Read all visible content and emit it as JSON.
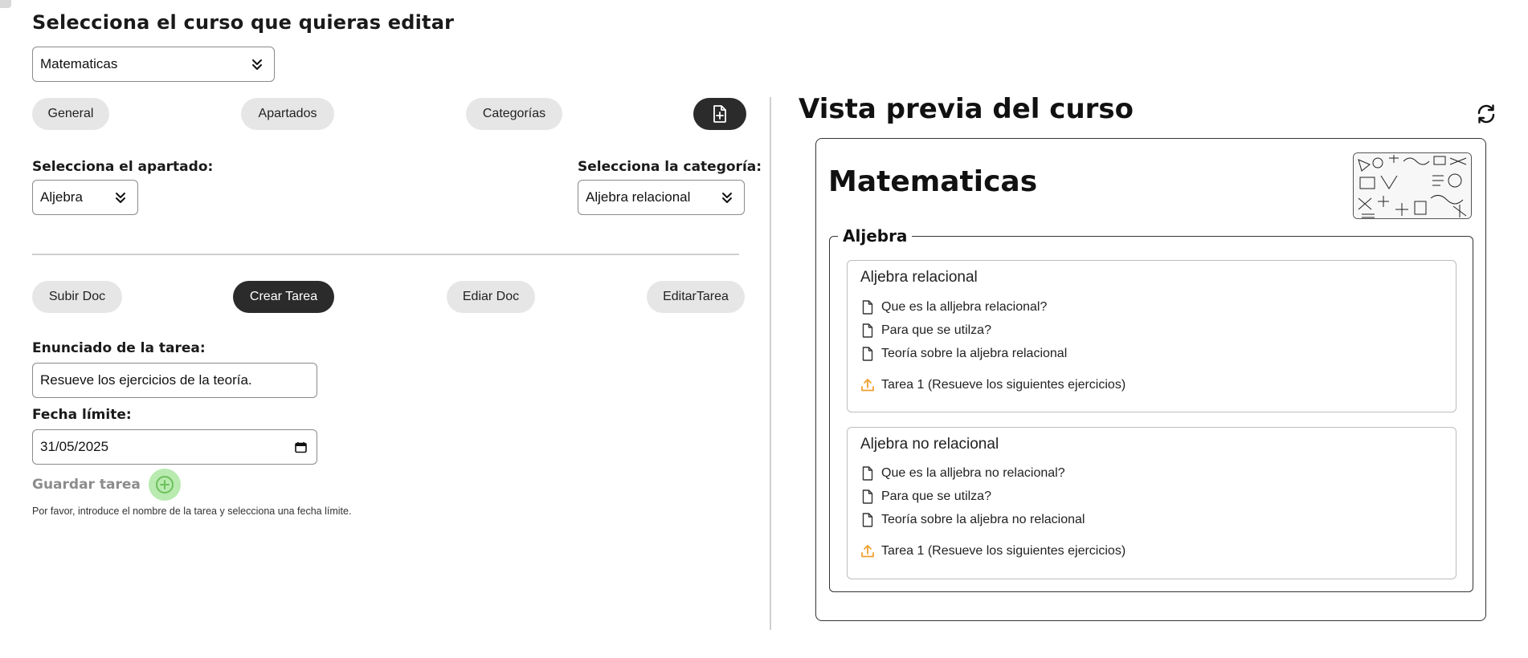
{
  "editor": {
    "title": "Selecciona el curso que quieras editar",
    "course_select": "Matematicas",
    "section_tabs": [
      "General",
      "Apartados",
      "Categorías"
    ],
    "section_label": "Selecciona el apartado:",
    "section_value": "Aljebra",
    "category_label": "Selecciona la categoría:",
    "category_value": "Aljebra relacional",
    "action_tabs": [
      "Subir Doc",
      "Crear Tarea",
      "Ediar Doc",
      "EditarTarea"
    ],
    "statement_label": "Enunciado de la tarea:",
    "statement_value": "Resueve los ejercicios de la teoría.",
    "deadline_label": "Fecha límite:",
    "deadline_value": "31/05/2025",
    "save_label": "Guardar tarea",
    "hint": "Por favor, introduce el nombre de la tarea y selecciona una fecha límite."
  },
  "preview": {
    "title": "Vista previa del curso",
    "course_name": "Matematicas",
    "section_name": "Aljebra",
    "categories": [
      {
        "name": "Aljebra relacional",
        "docs": [
          "Que es la alljebra relacional?",
          "Para que se utilza?",
          "Teoría sobre la aljebra relacional"
        ],
        "task": "Tarea 1 (Resueve los siguientes ejercicios)"
      },
      {
        "name": "Aljebra no relacional",
        "docs": [
          "Que es la alljebra no relacional?",
          "Para que se utilza?",
          "Teoría sobre la aljebra no relacional"
        ],
        "task": "Tarea 1 (Resueve los siguientes ejercicios)"
      }
    ]
  },
  "colors": {
    "dark_button": "#2b2b2b",
    "pill": "#e6e6e6",
    "save_green": "#b9eab0",
    "upload_orange": "#f0a030"
  },
  "icons": {
    "selects": "chevron-double-down-icon",
    "new_doc": "file-plus-icon",
    "refresh": "refresh-icon",
    "doc": "file-icon",
    "task": "upload-icon",
    "save": "plus-circle-icon",
    "calendar": "calendar-icon"
  }
}
